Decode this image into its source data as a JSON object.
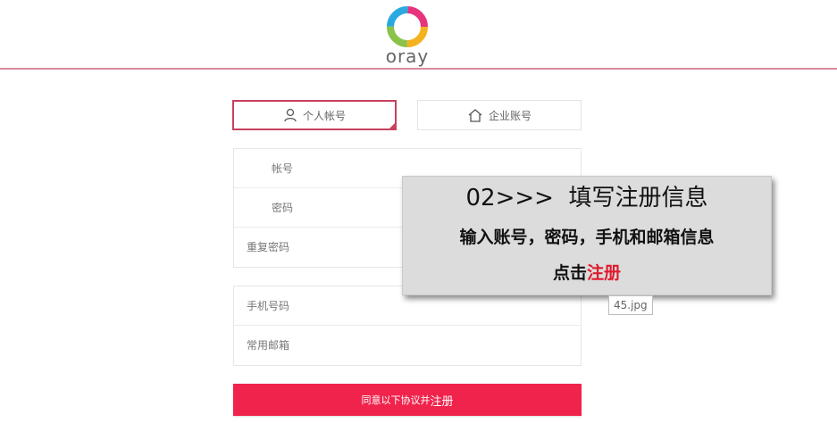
{
  "header": {
    "logo_text": "oray"
  },
  "tabs": [
    {
      "label": "个人帐号",
      "icon": "user-icon"
    },
    {
      "label": "企业账号",
      "icon": "home-icon"
    }
  ],
  "form": {
    "group1": [
      "帐号",
      "密码",
      "重复密码"
    ],
    "group2": [
      "手机号码",
      "常用邮箱"
    ]
  },
  "submit": {
    "prefix": "同意以下协议并",
    "emphasis": "注册"
  },
  "overlay": {
    "step_title": "02>>>  填写注册信息",
    "instruction": "输入账号，密码，手机和邮箱信息",
    "action_prefix": "点击",
    "action_highlight": "注册"
  },
  "file_tag": "45.jpg",
  "colors": {
    "accent": "#f0234c",
    "tab_border": "#c8415f",
    "highlight": "#e01b2f"
  }
}
